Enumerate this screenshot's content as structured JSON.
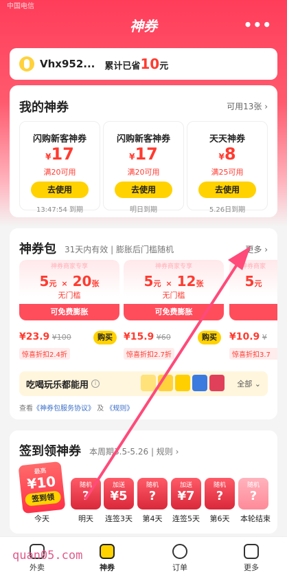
{
  "status": {
    "carrier": "中国电信"
  },
  "header": {
    "title": "神券",
    "menu": "•••"
  },
  "user": {
    "name": "Vhx952...",
    "saved_prefix": "累计已省",
    "saved_amount": "10",
    "saved_unit": "元"
  },
  "my_coupons": {
    "title": "我的神券",
    "link": "可用13张 ›",
    "items": [
      {
        "name": "闪购新客神券",
        "currency": "¥",
        "amount": "17",
        "cond": "满20可用",
        "btn": "去使用",
        "expire": "13:47:54 到期"
      },
      {
        "name": "闪购新客神券",
        "currency": "¥",
        "amount": "17",
        "cond": "满20可用",
        "btn": "去使用",
        "expire": "明日到期"
      },
      {
        "name": "天天神券",
        "currency": "¥",
        "amount": "8",
        "cond": "满25可用",
        "btn": "去使用",
        "expire": "5.26日到期"
      }
    ]
  },
  "packs": {
    "title": "神券包",
    "subtitle": "31天内有效 | 膨胀后门槛随机",
    "link": "更多 ›",
    "items": [
      {
        "tag": "神券商家专享",
        "value": "5",
        "unit": "元",
        "times": "×",
        "count": "20",
        "count_unit": "张",
        "sub": "无门槛",
        "foot": "可免费膨胀",
        "price": "¥23.9",
        "orig": "¥100",
        "buy": "购买",
        "disc": "惊喜折扣2.4折"
      },
      {
        "tag": "神券商家专享",
        "value": "5",
        "unit": "元",
        "times": "×",
        "count": "12",
        "count_unit": "张",
        "sub": "无门槛",
        "foot": "可免费膨胀",
        "price": "¥15.9",
        "orig": "¥60",
        "buy": "购买",
        "disc": "惊喜折扣2.7折"
      },
      {
        "tag": "神券商家",
        "value": "5",
        "unit": "元",
        "times": "",
        "count": "",
        "count_unit": "",
        "sub": "",
        "foot": "",
        "price": "¥10.9",
        "orig": "¥",
        "buy": "",
        "disc": "惊喜折扣3.7"
      }
    ],
    "eat_label": "吃喝玩乐都能用",
    "eat_all": "全部 ⌄",
    "agree_prefix": "查看",
    "agree_link1": "《神券包服务协议》",
    "agree_mid": "及",
    "agree_link2": "《规则》"
  },
  "checkin": {
    "title": "签到领神券",
    "period": "本周期3.5-5.26 | 规则 ›",
    "today": {
      "top": "最高",
      "amount": "¥10",
      "btn": "签到领",
      "label": "今天"
    },
    "days": [
      {
        "top": "随机",
        "q": "?",
        "label": "明天"
      },
      {
        "top": "加送",
        "q": "¥5",
        "label": "连签3天"
      },
      {
        "top": "随机",
        "q": "?",
        "label": "第4天"
      },
      {
        "top": "加送",
        "q": "¥7",
        "label": "连签5天"
      },
      {
        "top": "随机",
        "q": "?",
        "label": "第6天"
      },
      {
        "top": "随机",
        "q": "?",
        "label": "本轮结束"
      }
    ]
  },
  "tabbar": [
    {
      "label": "外卖",
      "icon": "takeout-icon"
    },
    {
      "label": "神券",
      "icon": "coupon-icon"
    },
    {
      "label": "订单",
      "icon": "order-icon"
    },
    {
      "label": "更多",
      "icon": "grid-icon"
    }
  ],
  "watermark": "quan05.com",
  "colors": {
    "accent": "#ff3b30",
    "brand_yellow": "#ffd200",
    "hero": "#ff3d5a"
  }
}
